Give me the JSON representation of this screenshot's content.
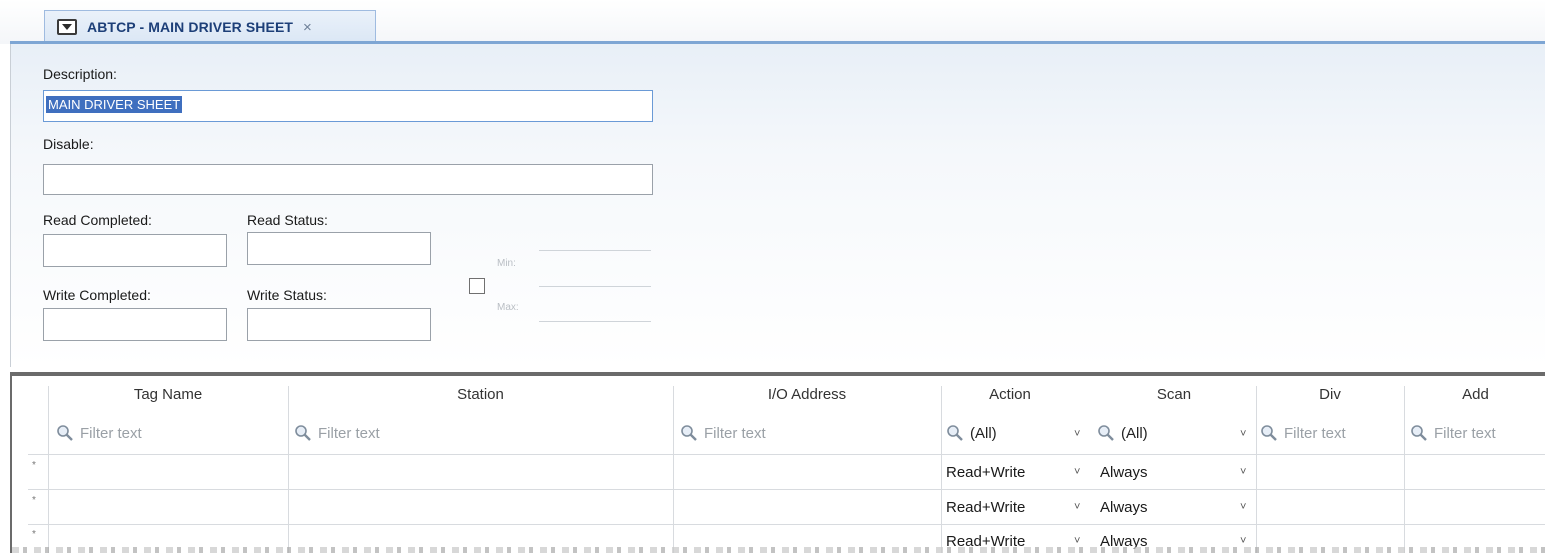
{
  "tab": {
    "title": "ABTCP - MAIN DRIVER SHEET",
    "close_glyph": "×",
    "icon": "sheet-dropdown-icon"
  },
  "form": {
    "description_label": "Description:",
    "description_value": "MAIN DRIVER SHEET",
    "disable_label": "Disable:",
    "disable_value": "",
    "read_completed_label": "Read Completed:",
    "read_status_label": "Read Status:",
    "write_completed_label": "Write Completed:",
    "write_status_label": "Write Status:",
    "min_label": "Min:",
    "max_label": "Max:"
  },
  "grid": {
    "columns": [
      "Tag Name",
      "Station",
      "I/O Address",
      "Action",
      "Scan",
      "Div",
      "Add"
    ],
    "filter_placeholder": "Filter text",
    "action_filter": "(All)",
    "scan_filter": "(All)",
    "row_marker": "*",
    "rows": [
      {
        "action": "Read+Write",
        "scan": "Always"
      },
      {
        "action": "Read+Write",
        "scan": "Always"
      },
      {
        "action": "Read+Write",
        "scan": "Always"
      }
    ]
  },
  "icons": {
    "filter": "magnifier-icon",
    "dropdown": "chevron-down-icon"
  },
  "colors": {
    "tab_accent": "#7ea6d4",
    "selection": "#3f6fbf",
    "tab_title": "#1d3f78"
  }
}
